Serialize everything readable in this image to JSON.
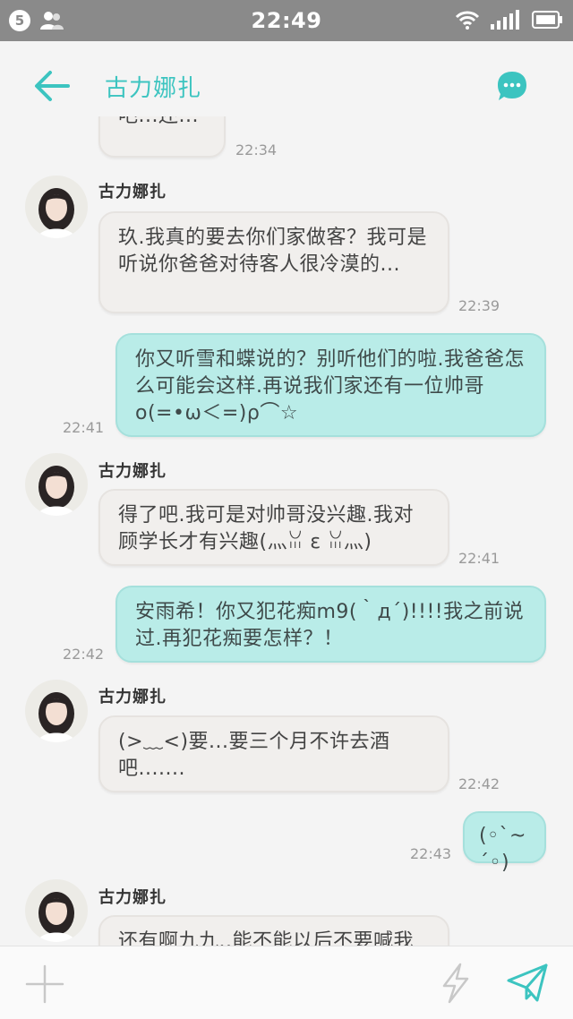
{
  "status_bar": {
    "sim_number": "5",
    "time": "22:49"
  },
  "header": {
    "title": "古力娜扎",
    "back_icon": "arrow-left-icon",
    "menu_icon": "chat-bubble-icon"
  },
  "colors": {
    "accent": "#3cc4c0",
    "incoming_bubble": "#f1efed",
    "outgoing_bubble": "#b9ece8"
  },
  "messages": [
    {
      "direction": "in",
      "sender": "",
      "text": "吧...还...",
      "time": "22:34"
    },
    {
      "direction": "in",
      "sender": "古力娜扎",
      "text": "玖.我真的要去你们家做客？我可是听说你爸爸对待客人很冷漠的...",
      "time": "22:39"
    },
    {
      "direction": "out",
      "text": "你又听雪和蝶说的？别听他们的啦.我爸爸怎么可能会这样.再说我们家还有一位帅哥o(=•ω＜=)ρ⌒☆",
      "time": "22:41"
    },
    {
      "direction": "in",
      "sender": "古力娜扎",
      "text": "得了吧.我可是对帅哥没兴趣.我对顾学长才有兴趣(灬ꈍ ε ꈍ灬)",
      "time": "22:41"
    },
    {
      "direction": "out",
      "text": "安雨希！你又犯花痴m9(｀д´)!!!!我之前说过.再犯花痴要怎样？！",
      "time": "22:42"
    },
    {
      "direction": "in",
      "sender": "古力娜扎",
      "text": "(>﹏<)要...要三个月不许去酒吧.......",
      "time": "22:42"
    },
    {
      "direction": "out",
      "text": "(◦`~´◦)",
      "time": "22:43"
    },
    {
      "direction": "in",
      "sender": "古力娜扎",
      "text": "还有啊九九..能不能以后不要喊我",
      "time": ""
    }
  ],
  "input_bar": {
    "plus_icon": "plus-icon",
    "quick_icon": "lightning-icon",
    "send_icon": "send-icon"
  }
}
